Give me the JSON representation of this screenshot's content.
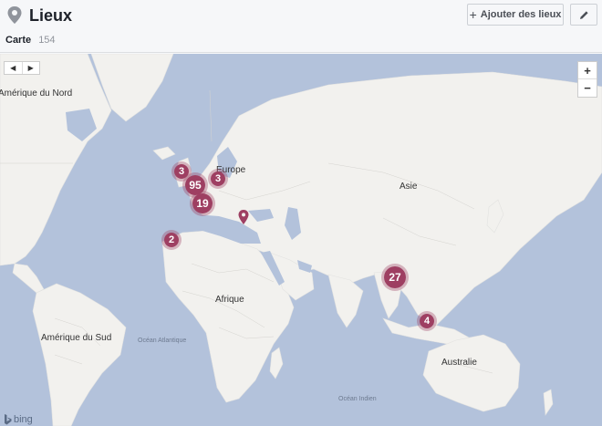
{
  "header": {
    "title": "Lieux",
    "tab_label": "Carte",
    "tab_count": "154",
    "add_button_label": "Ajouter des lieux",
    "add_icon": "+",
    "edit_icon": "pencil-icon"
  },
  "map": {
    "labels": {
      "north_america": "Amérique du Nord",
      "europe": "Europe",
      "asia": "Asie",
      "africa": "Afrique",
      "south_america": "Amérique du Sud",
      "australia": "Australie",
      "atlantic": "Océan Atlantique",
      "indian": "Océan Indien"
    },
    "clusters": {
      "uk": "3",
      "france": "95",
      "central_europe": "3",
      "spain": "19",
      "canary": "2",
      "southeast_asia": "27",
      "indonesia": "4"
    },
    "controls": {
      "zoom_in": "+",
      "zoom_out": "−",
      "prev": "◀",
      "next": "▶"
    },
    "provider": "bing"
  },
  "colors": {
    "ocean": "#b3c2db",
    "land": "#f2f1ee",
    "cluster": "#9e3f62"
  }
}
